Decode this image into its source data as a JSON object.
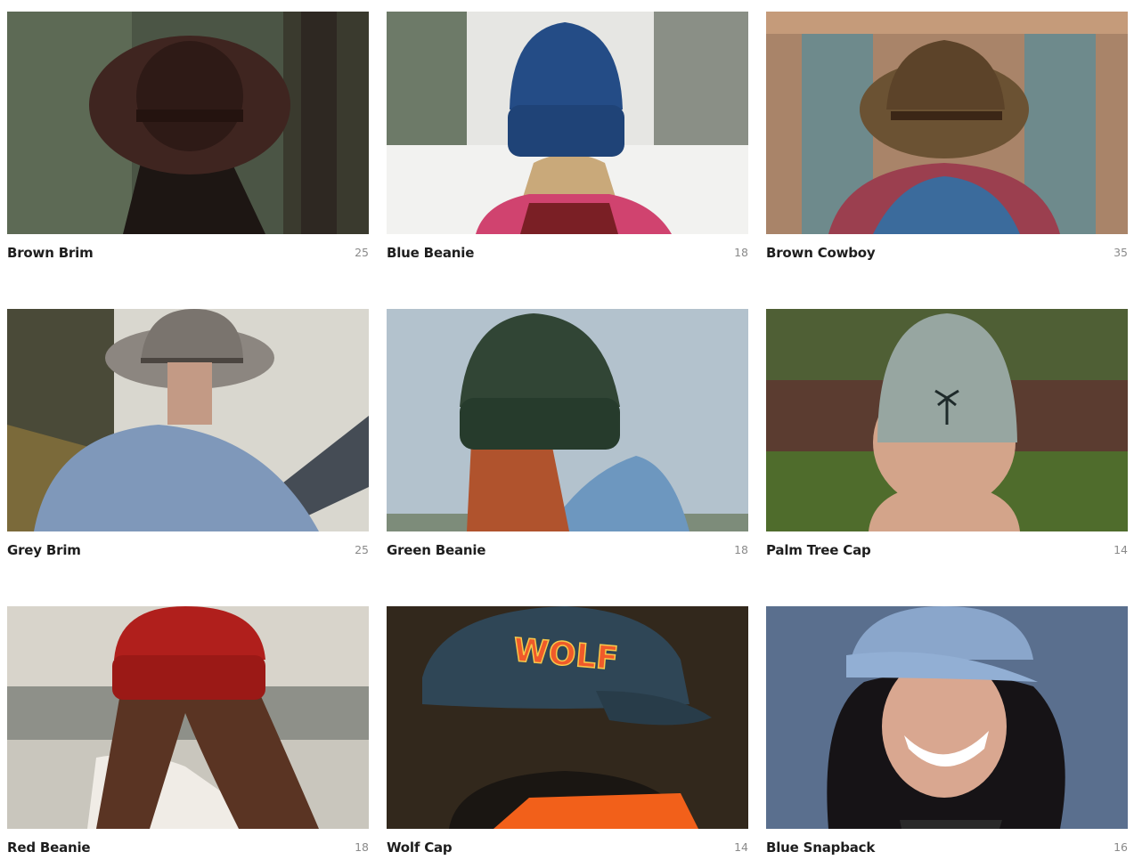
{
  "products": [
    {
      "name": "Brown Brim",
      "count": "25",
      "hat_color": "#3f2520",
      "bg_color": "#4b5545"
    },
    {
      "name": "Blue Beanie",
      "count": "18",
      "hat_color": "#244c86",
      "bg_color": "#e6e6e3"
    },
    {
      "name": "Brown Cowboy",
      "count": "35",
      "hat_color": "#6b5233",
      "bg_color": "#a98469"
    },
    {
      "name": "Grey Brim",
      "count": "25",
      "hat_color": "#8c8680",
      "bg_color": "#d9d7cf"
    },
    {
      "name": "Green Beanie",
      "count": "18",
      "hat_color": "#314535",
      "bg_color": "#b3c2cd"
    },
    {
      "name": "Palm Tree Cap",
      "count": "14",
      "hat_color": "#97a6a1",
      "bg_color": "#3d4f2a"
    },
    {
      "name": "Red Beanie",
      "count": "18",
      "hat_color": "#b01f1c",
      "bg_color": "#c9c6bd"
    },
    {
      "name": "Wolf Cap",
      "count": "14",
      "hat_color": "#2f4656",
      "bg_color": "#2a2219",
      "hat_text": "WOLF"
    },
    {
      "name": "Blue Snapback",
      "count": "16",
      "hat_color": "#92afd4",
      "bg_color": "#5a6f8e"
    }
  ]
}
